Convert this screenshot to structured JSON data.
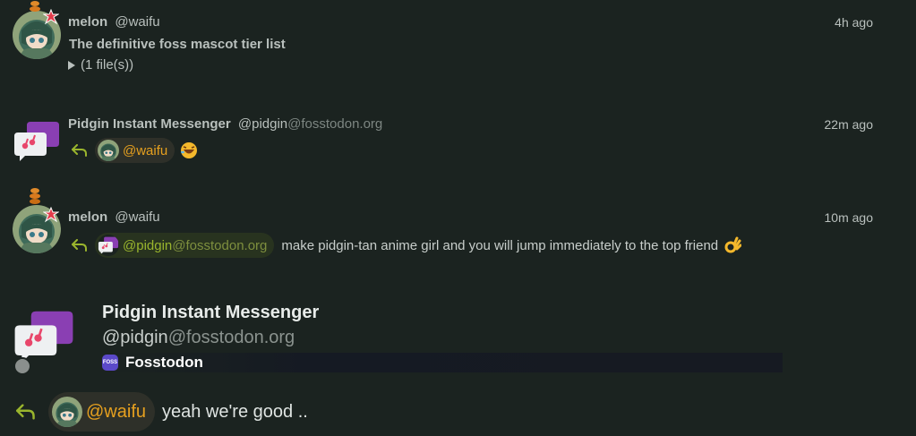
{
  "posts": [
    {
      "author_name": "melon",
      "author_handle": "@waifu",
      "time": "4h ago",
      "subject": "The definitive foss mascot tier list",
      "attachments": "(1 file(s))"
    },
    {
      "author_name": "Pidgin Instant Messenger",
      "author_handle_user": "@pidgin",
      "author_handle_domain": "@fosstodon.org",
      "time": "22m ago",
      "mention": "@waifu",
      "emoji": "rolling-on-floor-laughing"
    },
    {
      "author_name": "melon",
      "author_handle": "@waifu",
      "time": "10m ago",
      "mention_user": "@pidgin",
      "mention_domain": "@fosstodon.org",
      "text": "make pidgin-tan anime girl and you will jump immediately to the top friend",
      "emoji": "ok-hand"
    }
  ],
  "focused": {
    "author_name": "Pidgin Instant Messenger",
    "author_handle_user": "@pidgin",
    "author_handle_domain": "@fosstodon.org",
    "instance_name": "Fosstodon",
    "instance_icon_text": "FOSS",
    "mention": "@waifu",
    "text": "yeah we're good .."
  },
  "colors": {
    "background": "#1b2320",
    "mention_orange": "#e6a01f",
    "mention_green": "#9ab52d",
    "reply_arrow": "#9ab52d",
    "pidgin_purple": "#8a3fb3",
    "pidgin_pink": "#e8466b"
  },
  "icons": [
    "anger-symbol-badge",
    "reply-arrow-icon",
    "pidgin-logo",
    "fosstodon-icon",
    "disclosure-triangle-icon"
  ]
}
